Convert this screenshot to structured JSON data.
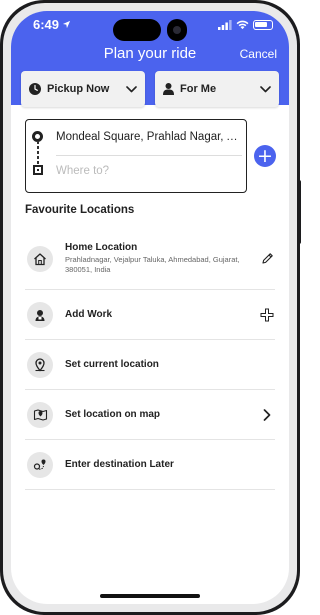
{
  "status_bar": {
    "time": "6:49"
  },
  "header": {
    "title": "Plan your ride",
    "cancel_label": "Cancel"
  },
  "pickup_dropdown": {
    "label": "Pickup Now"
  },
  "rider_dropdown": {
    "label": "For Me"
  },
  "route": {
    "pickup_value": "Mondeal Square, Prahlad Nagar, Ahmedabad",
    "destination_placeholder": "Where to?"
  },
  "favourites": {
    "title": "Favourite Locations",
    "items": [
      {
        "label": "Home Location",
        "sub": "Prahladnagar, Vejalpur Taluka, Ahmedabad, Gujarat, 380051, India",
        "icon": "home-icon",
        "action": "edit-icon"
      },
      {
        "label": "Add Work",
        "icon": "work-icon",
        "action": "plus-icon"
      },
      {
        "label": "Set current location",
        "icon": "location-pin-icon"
      },
      {
        "label": "Set location on map",
        "icon": "map-icon",
        "action": "chevron-right-icon"
      },
      {
        "label": "Enter destination Later",
        "icon": "route-icon"
      }
    ]
  },
  "colors": {
    "accent": "#4b63ee",
    "frame": "#1c1c1e"
  }
}
